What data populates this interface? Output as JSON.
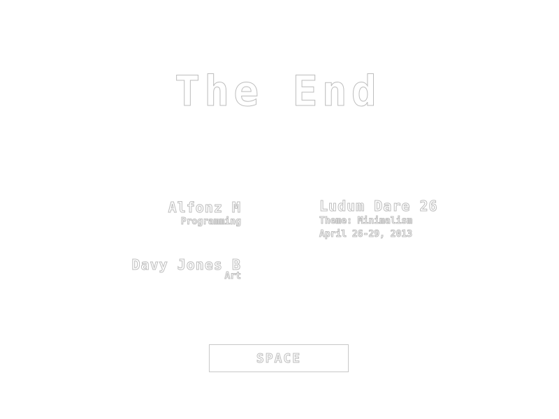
{
  "screen": {
    "title": "The End"
  },
  "credits": [
    {
      "name": "Alfonz M",
      "role": "Programming"
    },
    {
      "name": "Davy Jones B",
      "role": "Art"
    }
  ],
  "event": {
    "title": "Ludum Dare 26",
    "theme": "Theme: Minimalism",
    "dates": "April 26-29, 2013"
  },
  "button": {
    "label": "SPACE"
  },
  "colors": {
    "background": "#ffffff",
    "outline": "#bdbdbd"
  }
}
